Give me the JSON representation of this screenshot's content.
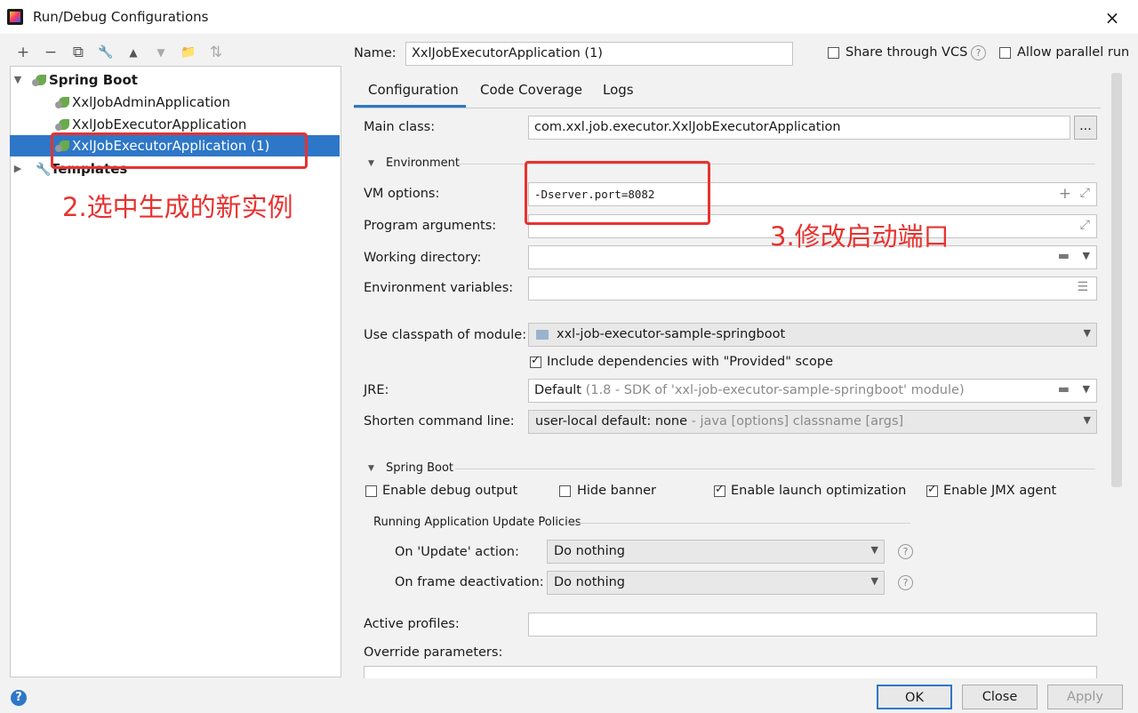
{
  "window": {
    "title": "Run/Debug Configurations",
    "close_icon": "×"
  },
  "toolbar": {
    "add": "+",
    "remove": "−",
    "copy": "⧉",
    "edit": "🔧",
    "up": "▲",
    "down": "▼",
    "folder": "📁",
    "sort": "⇅"
  },
  "tree": {
    "root_label": "Spring Boot",
    "items": [
      "XxlJobAdminApplication",
      "XxlJobExecutorApplication",
      "XxlJobExecutorApplication (1)"
    ],
    "templates_label": "Templates"
  },
  "annotations": {
    "step2": "2.选中生成的新实例",
    "step3": "3.修改启动端口"
  },
  "header": {
    "name_label": "Name:",
    "name_value": "XxlJobExecutorApplication (1)",
    "share_label": "Share through VCS",
    "allow_parallel_label": "Allow parallel run",
    "share_checked": false,
    "parallel_checked": false
  },
  "tabs": [
    "Configuration",
    "Code Coverage",
    "Logs"
  ],
  "form": {
    "main_class_label": "Main class:",
    "main_class_value": "com.xxl.job.executor.XxlJobExecutorApplication",
    "browse_label": "...",
    "environment_label": "Environment",
    "vm_options_label": "VM options:",
    "vm_options_value": "-Dserver.port=8082",
    "program_args_label": "Program arguments:",
    "working_dir_label": "Working directory:",
    "env_vars_label": "Environment variables:",
    "classpath_label": "Use classpath of module:",
    "classpath_value": "xxl-job-executor-sample-springboot",
    "include_deps_label": "Include dependencies with \"Provided\" scope",
    "include_deps_checked": true,
    "jre_label": "JRE:",
    "jre_value": "Default",
    "jre_hint": "(1.8 - SDK of 'xxl-job-executor-sample-springboot' module)",
    "shorten_label": "Shorten command line:",
    "shorten_value": "user-local default: none",
    "shorten_hint": "- java [options] classname [args]"
  },
  "spring_boot": {
    "section_label": "Spring Boot",
    "debug_output_label": "Enable debug output",
    "hide_banner_label": "Hide banner",
    "launch_opt_label": "Enable launch optimization",
    "jmx_label": "Enable JMX agent",
    "debug_checked": false,
    "hide_banner_checked": false,
    "launch_opt_checked": true,
    "jmx_checked": true,
    "policies_label": "Running Application Update Policies",
    "on_update_label": "On 'Update' action:",
    "on_update_value": "Do nothing",
    "on_frame_label": "On frame deactivation:",
    "on_frame_value": "Do nothing",
    "active_profiles_label": "Active profiles:",
    "override_label": "Override parameters:"
  },
  "footer": {
    "ok": "OK",
    "close": "Close",
    "apply": "Apply",
    "help": "?"
  }
}
